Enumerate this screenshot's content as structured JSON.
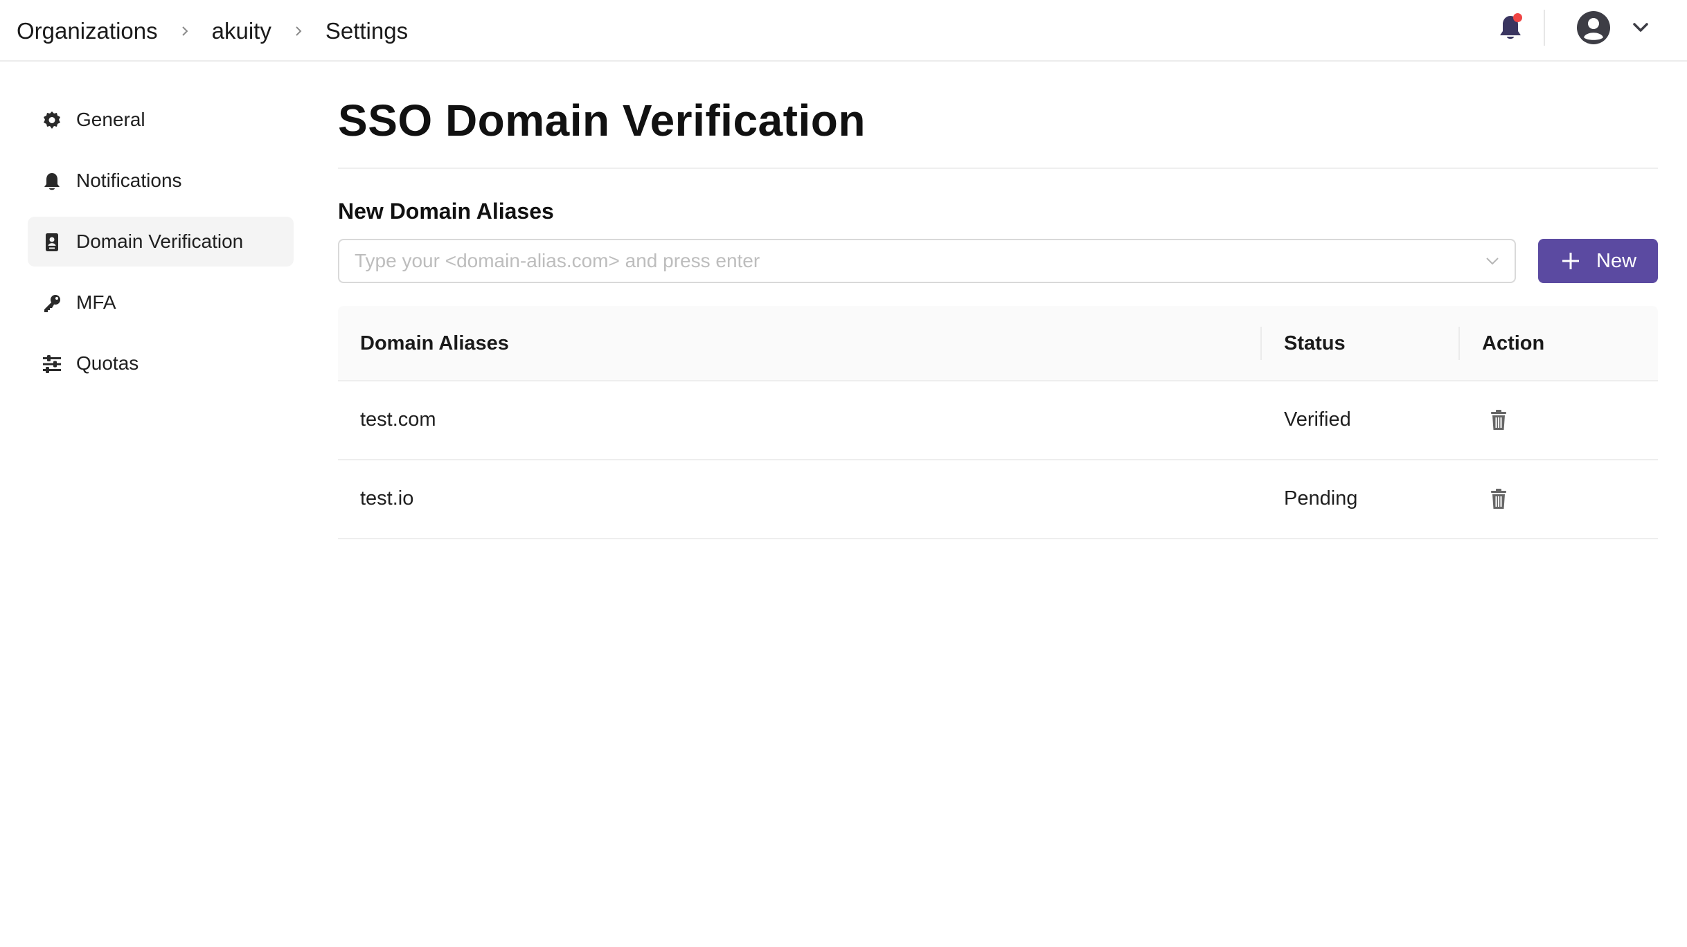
{
  "breadcrumb": {
    "items": [
      "Organizations",
      "akuity",
      "Settings"
    ]
  },
  "header": {
    "bell_icon": "bell-icon",
    "avatar_icon": "user-circle-icon",
    "menu_icon": "chevron-down-icon",
    "notification_dot_color": "#ef4444"
  },
  "sidebar": {
    "items": [
      {
        "label": "General",
        "icon": "gear-icon",
        "active": false
      },
      {
        "label": "Notifications",
        "icon": "bell-icon",
        "active": false
      },
      {
        "label": "Domain Verification",
        "icon": "id-badge-icon",
        "active": true
      },
      {
        "label": "MFA",
        "icon": "key-icon",
        "active": false
      },
      {
        "label": "Quotas",
        "icon": "sliders-icon",
        "active": false
      }
    ]
  },
  "main": {
    "title": "SSO Domain Verification",
    "new_aliases_label": "New Domain Aliases",
    "input": {
      "placeholder": "Type your <domain-alias.com> and press enter",
      "value": ""
    },
    "new_button_label": "New",
    "accent_color": "#5b4aa1"
  },
  "table": {
    "columns": [
      "Domain Aliases",
      "Status",
      "Action"
    ],
    "rows": [
      {
        "domain": "test.com",
        "status": "Verified",
        "action_icon": "trash-icon"
      },
      {
        "domain": "test.io",
        "status": "Pending",
        "action_icon": "trash-icon"
      }
    ]
  }
}
